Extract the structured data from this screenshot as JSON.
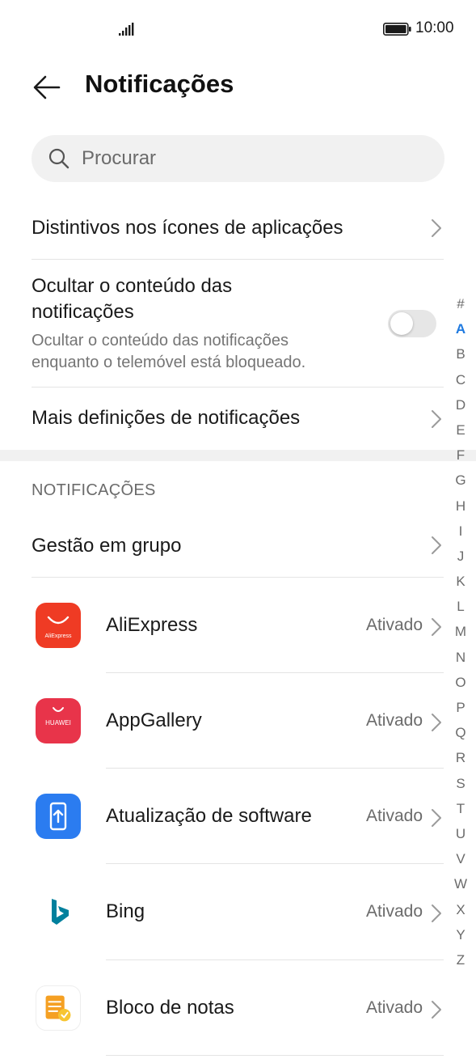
{
  "status_bar": {
    "time": "10:00"
  },
  "header": {
    "title": "Notificações"
  },
  "search": {
    "placeholder": "Procurar"
  },
  "settings": {
    "badges_label": "Distintivos nos ícones de aplicações",
    "hide_content_title_line1": "Ocultar o conteúdo das",
    "hide_content_title_line2": "notificações",
    "hide_content_sub_line1": "Ocultar o conteúdo das notificações",
    "hide_content_sub_line2": "enquanto o telemóvel está bloqueado.",
    "hide_content_enabled": false,
    "more_settings_label": "Mais definições de notificações"
  },
  "notifications_section": {
    "header": "NOTIFICAÇÕES",
    "group_management_label": "Gestão em grupo",
    "apps": [
      {
        "name": "AliExpress",
        "status": "Ativado",
        "icon": "aliexpress-icon",
        "icon_text": "AliExpress"
      },
      {
        "name": "AppGallery",
        "status": "Ativado",
        "icon": "appgallery-icon",
        "icon_text": "HUAWEI"
      },
      {
        "name": "Atualização de software",
        "status": "Ativado",
        "icon": "software-update-icon"
      },
      {
        "name": "Bing",
        "status": "Ativado",
        "icon": "bing-icon"
      },
      {
        "name": "Bloco de notas",
        "status": "Ativado",
        "icon": "notepad-icon"
      }
    ]
  },
  "alpha_index": {
    "letters": [
      "#",
      "A",
      "B",
      "C",
      "D",
      "E",
      "F",
      "G",
      "H",
      "I",
      "J",
      "K",
      "L",
      "M",
      "N",
      "O",
      "P",
      "Q",
      "R",
      "S",
      "T",
      "U",
      "V",
      "W",
      "X",
      "Y",
      "Z"
    ],
    "active": "A"
  },
  "colors": {
    "accent": "#1f7ae0",
    "aliexpress": "#ef3b24",
    "appgallery": "#e8344a",
    "software_update": "#2b7cf0",
    "bing": "#00809d",
    "notepad": "#f5a023"
  }
}
